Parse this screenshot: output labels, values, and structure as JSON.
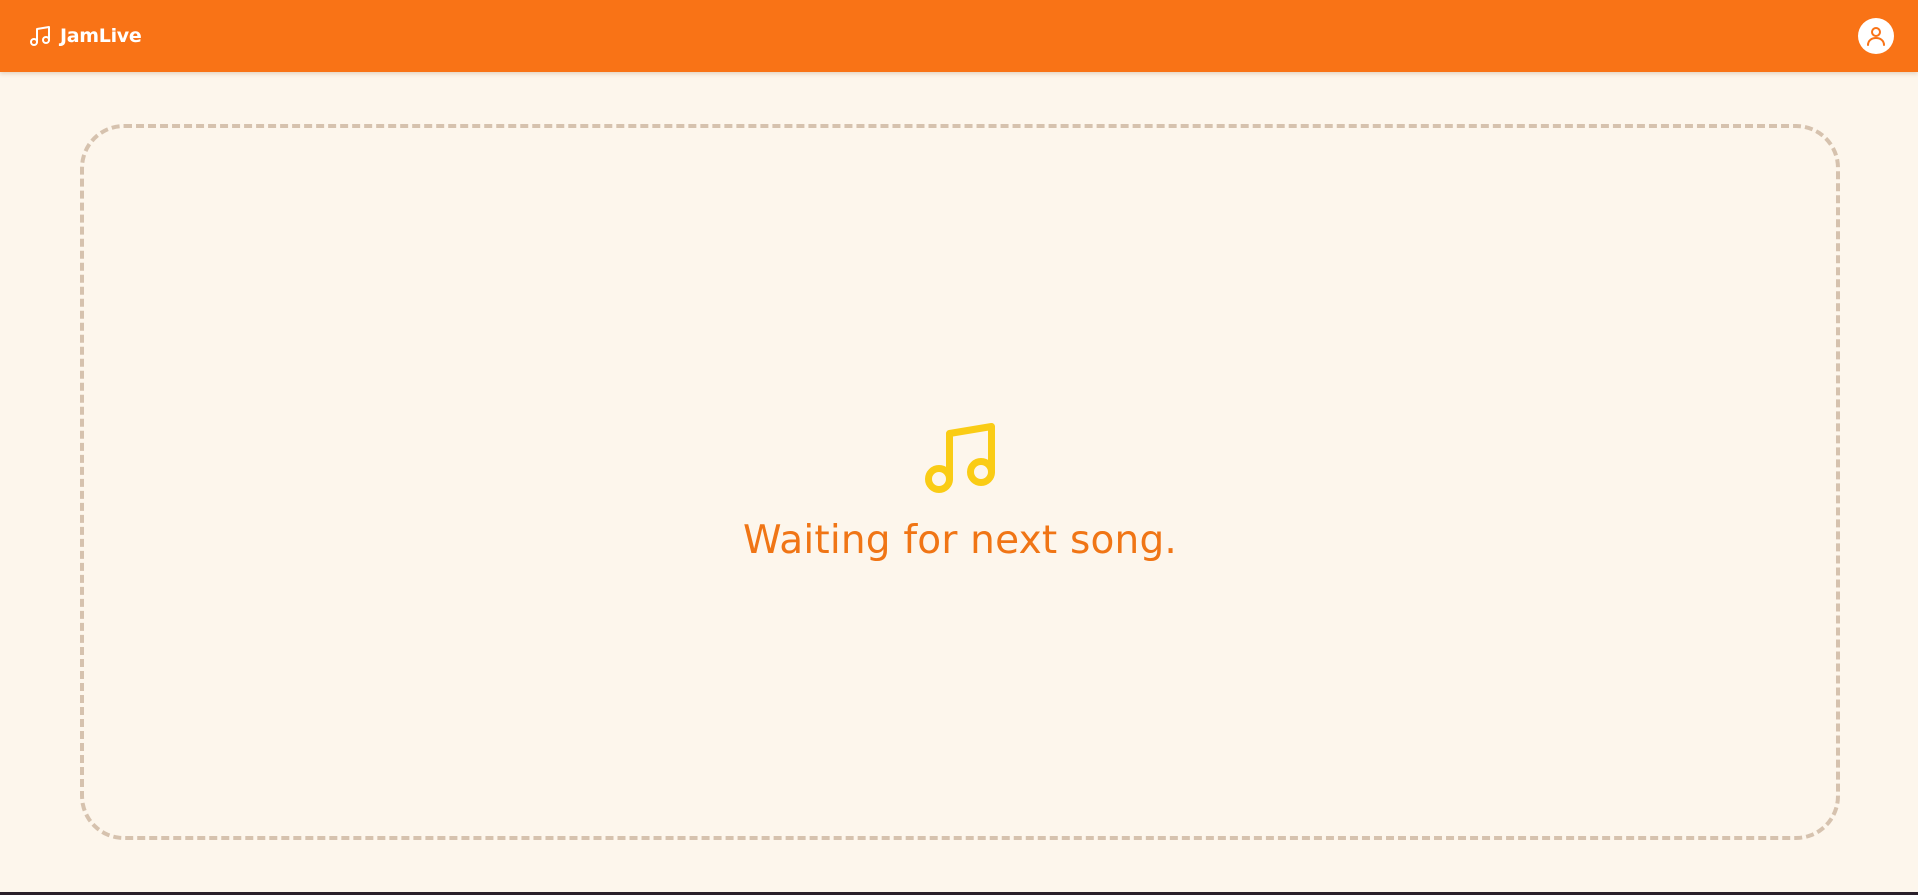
{
  "header": {
    "brand_name": "JamLive",
    "brand_icon": "music-note-icon",
    "profile_icon": "user-icon",
    "background_color": "#f97316"
  },
  "main": {
    "status_icon": "music-note-icon",
    "status_text": "Waiting for next song.",
    "status_text_color": "#f07515",
    "status_icon_color": "#facc15",
    "panel_border_color": "#d6c2ae"
  }
}
